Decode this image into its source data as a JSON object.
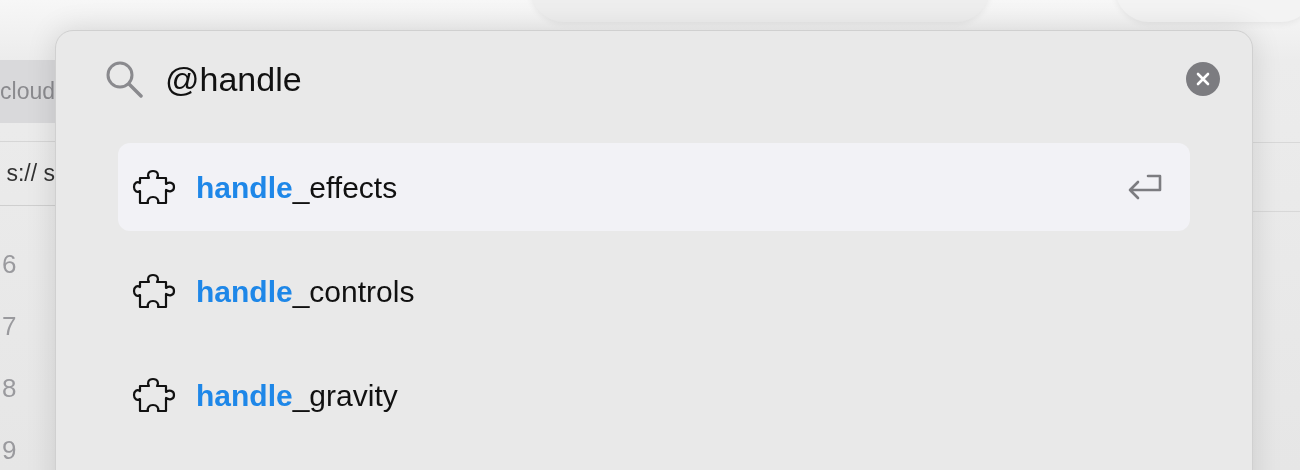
{
  "background_editor": {
    "tab_label": "cloud",
    "address": "s:// s",
    "line_numbers": [
      "6",
      "7",
      "8",
      "9"
    ]
  },
  "search": {
    "value": "@handle"
  },
  "results": [
    {
      "label": "**handle**_effects",
      "selected": true
    },
    {
      "label": "**handle**_controls",
      "selected": false
    },
    {
      "label": "**handle**_gravity",
      "selected": false
    }
  ]
}
